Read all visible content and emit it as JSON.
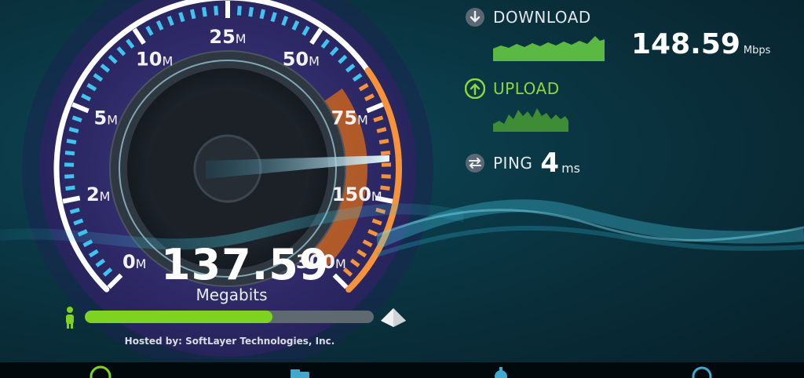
{
  "gauge": {
    "ticks": [
      {
        "num": "0",
        "unit": "M"
      },
      {
        "num": "2",
        "unit": "M"
      },
      {
        "num": "5",
        "unit": "M"
      },
      {
        "num": "10",
        "unit": "M"
      },
      {
        "num": "25",
        "unit": "M"
      },
      {
        "num": "50",
        "unit": "M"
      },
      {
        "num": "75",
        "unit": "M"
      },
      {
        "num": "150",
        "unit": "M"
      },
      {
        "num": "300",
        "unit": "M"
      }
    ],
    "current_speed": "137.59",
    "current_unit": "Megabits"
  },
  "progress": {
    "fraction": 0.65
  },
  "server": {
    "hosted_by": "Hosted by: SoftLayer Technologies, Inc."
  },
  "download": {
    "label": "DOWNLOAD",
    "value": "148.59",
    "unit": "Mbps"
  },
  "upload": {
    "label": "UPLOAD"
  },
  "ping": {
    "label": "PING",
    "value": "4",
    "unit": "ms"
  },
  "colors": {
    "accent_blue": "#3fc3f0",
    "accent_orange": "#f5923a",
    "progress_green": "#7ed321",
    "upload_green": "#8fd63a"
  },
  "icons": {
    "download": "download-circle-icon",
    "upload": "upload-circle-icon",
    "ping": "ping-arrows-icon",
    "person": "person-icon",
    "server": "server-pyramid-icon",
    "tabs": [
      "speed-tab-icon",
      "results-tab-icon",
      "settings-tab-icon",
      "info-tab-icon"
    ]
  }
}
